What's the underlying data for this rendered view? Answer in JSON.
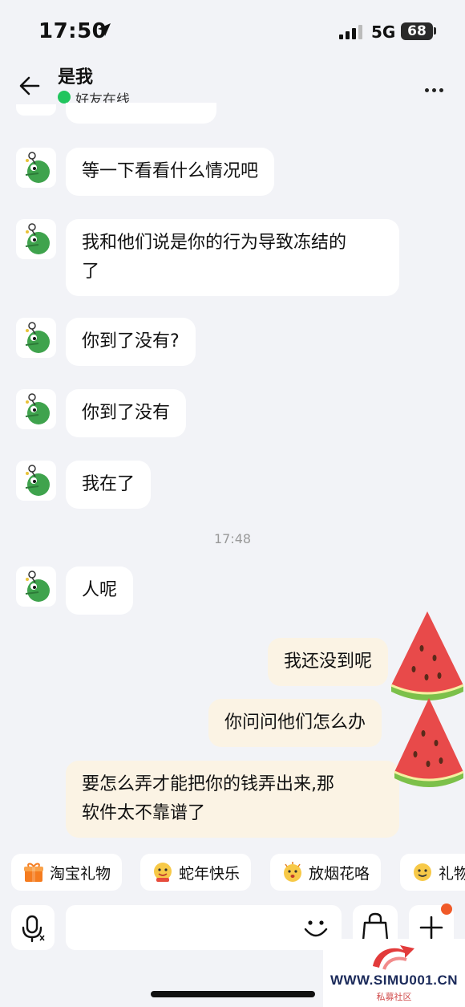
{
  "status": {
    "time": "17:50",
    "network": "5G",
    "battery": "68"
  },
  "header": {
    "title": "是我",
    "status_text": "好友在线"
  },
  "messages": [
    {
      "sender": "friend",
      "text": "等一下看看什么情况吧"
    },
    {
      "sender": "friend",
      "text": "我和他们说是你的行为导致冻结的\n了"
    },
    {
      "sender": "friend",
      "text": "你到了没有?"
    },
    {
      "sender": "friend",
      "text": "你到了没有"
    },
    {
      "sender": "friend",
      "text": "我在了"
    },
    {
      "sender": "friend",
      "text": "人呢"
    },
    {
      "sender": "me",
      "text": "我还没到呢"
    },
    {
      "sender": "me",
      "text": "你问问他们怎么办"
    },
    {
      "sender": "me",
      "text": "要怎么弄才能把你的钱弄出来,那\n软件太不靠谱了"
    }
  ],
  "timestamp": "17:48",
  "quick_chips": [
    "淘宝礼物",
    "蛇年快乐",
    "放烟花咯",
    "礼物"
  ],
  "watermark": {
    "site": "WWW.SIMU001.CN",
    "caption": "私募社区"
  },
  "colors": {
    "online": "#22c55e",
    "my_bubble": "#fbf3e4",
    "badge": "#f05a28"
  }
}
